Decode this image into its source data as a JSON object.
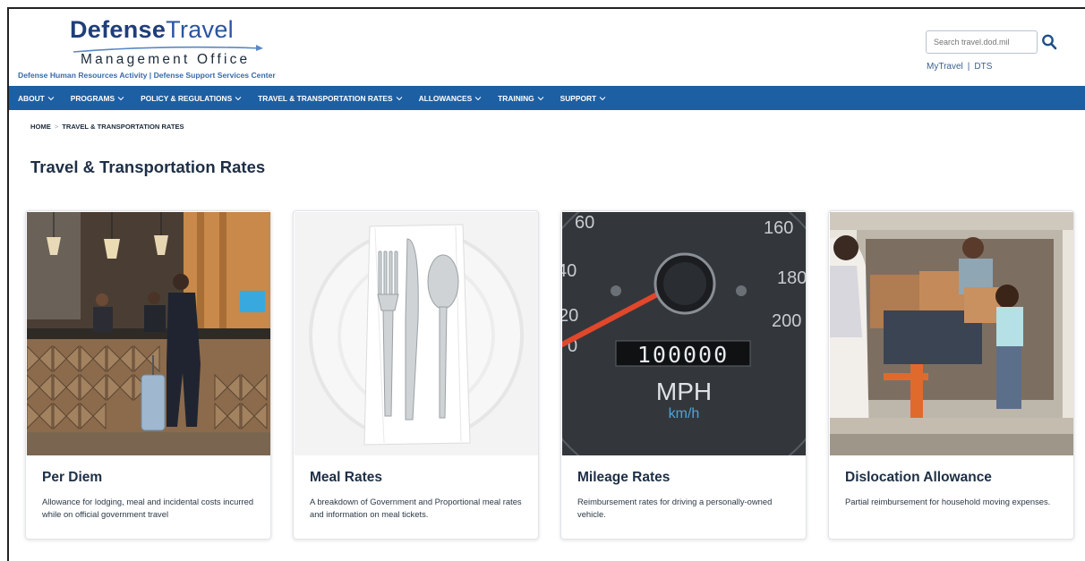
{
  "header": {
    "logo_main": "Defense",
    "logo_light": "Travel",
    "logo_sub": "Management Office",
    "logo_org": "Defense Human Resources Activity | Defense Support Services Center",
    "search_placeholder": "Search travel.dod.mil",
    "links": [
      "MyTravel",
      "DTS"
    ],
    "link_separator": "|"
  },
  "nav": {
    "items": [
      "ABOUT",
      "PROGRAMS",
      "POLICY & REGULATIONS",
      "TRAVEL & TRANSPORTATION RATES",
      "ALLOWANCES",
      "TRAINING",
      "SUPPORT"
    ],
    "background": "#1d5fa3"
  },
  "breadcrumb": {
    "home": "HOME",
    "separator": ">",
    "current": "TRAVEL & TRANSPORTATION RATES"
  },
  "page": {
    "title": "Travel & Transportation Rates"
  },
  "cards": [
    {
      "title": "Per Diem",
      "description": "Allowance for lodging, meal and incidental costs incurred while on official government travel",
      "image": "hotel-reception-photo"
    },
    {
      "title": "Meal Rates",
      "description": "A breakdown of Government and Proportional meal rates and information on meal tickets.",
      "image": "plate-and-cutlery-photo"
    },
    {
      "title": "Mileage Rates",
      "description": "Reimbursement rates for driving a personally-owned vehicle.",
      "image": "speedometer-photo",
      "speedo": {
        "labels": [
          "60",
          "160",
          "40",
          "180",
          "20",
          "200",
          "0"
        ],
        "odometer": "100000",
        "unit_primary": "MPH",
        "unit_secondary": "km/h"
      }
    },
    {
      "title": "Dislocation Allowance",
      "description": "Partial reimbursement for household moving expenses.",
      "image": "family-moving-boxes-photo"
    }
  ]
}
